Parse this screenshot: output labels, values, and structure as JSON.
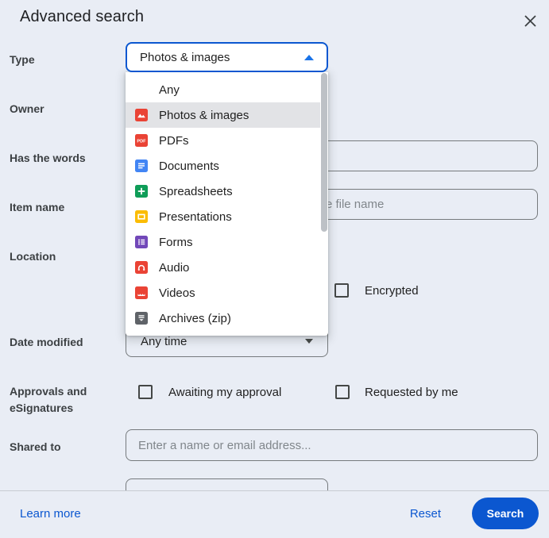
{
  "dialog": {
    "title": "Advanced search"
  },
  "labels": {
    "type": "Type",
    "owner": "Owner",
    "has_words": "Has the words",
    "item_name": "Item name",
    "location": "Location",
    "date_modified": "Date modified",
    "approvals": "Approvals and eSignatures",
    "shared_to": "Shared to"
  },
  "type_select": {
    "value": "Photos & images"
  },
  "dropdown": {
    "selected": "Photos & images",
    "items": [
      {
        "label": "Any",
        "icon": "none",
        "color": ""
      },
      {
        "label": "Photos & images",
        "icon": "photos-icon",
        "color": "#ea4335"
      },
      {
        "label": "PDFs",
        "icon": "pdf-icon",
        "color": "#ea4335"
      },
      {
        "label": "Documents",
        "icon": "docs-icon",
        "color": "#4285f4"
      },
      {
        "label": "Spreadsheets",
        "icon": "sheets-icon",
        "color": "#0f9d58"
      },
      {
        "label": "Presentations",
        "icon": "slides-icon",
        "color": "#fbbc04"
      },
      {
        "label": "Forms",
        "icon": "forms-icon",
        "color": "#7248b9"
      },
      {
        "label": "Audio",
        "icon": "audio-icon",
        "color": "#ea4335"
      },
      {
        "label": "Videos",
        "icon": "videos-icon",
        "color": "#ea4335"
      },
      {
        "label": "Archives (zip)",
        "icon": "archive-icon",
        "color": "#5f6368"
      }
    ]
  },
  "fields": {
    "has_words_value": "",
    "item_name_placeholder": "Enter a term that matches part of the file name",
    "shared_to_placeholder": "Enter a name or email address...",
    "date_modified_value": "Any time"
  },
  "checkboxes": {
    "encrypted": "Encrypted",
    "awaiting_approval": "Awaiting my approval",
    "requested_by_me": "Requested by me"
  },
  "footer": {
    "learn_more": "Learn more",
    "reset": "Reset",
    "search": "Search"
  },
  "colors": {
    "accent_blue": "#0b57d0",
    "caret_blue": "#1a73e8",
    "dialog_bg": "#e9edf5",
    "highlight_row": "#e2e3e6"
  }
}
